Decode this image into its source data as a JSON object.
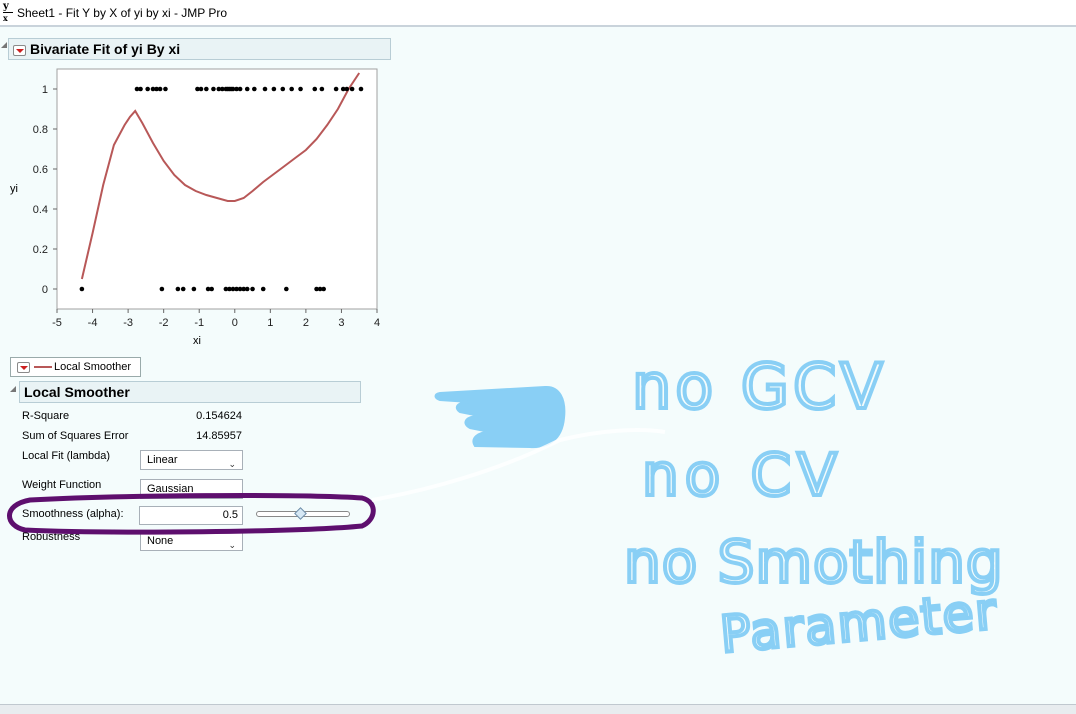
{
  "window": {
    "title": "Sheet1 - Fit Y by X of yi by xi - JMP Pro",
    "icon_text": "y"
  },
  "report": {
    "header": "Bivariate Fit of yi By xi",
    "legend_label": "Local Smoother",
    "smoother_header": "Local Smoother",
    "stats": [
      {
        "label": "R-Square",
        "value": "0.154624"
      },
      {
        "label": "Sum of Squares Error",
        "value": "14.85957"
      }
    ],
    "local_fit": {
      "label": "Local Fit (lambda)",
      "value": "Linear"
    },
    "weight_function": {
      "label": "Weight Function",
      "value": "Gaussian"
    },
    "smoothness": {
      "label": "Smoothness (alpha):",
      "value": "0.5",
      "slider_level": 0.5
    },
    "robustness": {
      "label": "Robustness",
      "value": "None"
    }
  },
  "annotation": {
    "lines": [
      "no GCV",
      "no CV",
      "no Smothing",
      "Parameter"
    ],
    "ink_color": "#89cff5",
    "circle_color": "#5e0f6e"
  },
  "chart_data": {
    "type": "scatter",
    "xlabel": "xi",
    "ylabel": "yi",
    "xlim": [
      -5,
      4
    ],
    "ylim": [
      -0.1,
      1.1
    ],
    "xticks": [
      "-5",
      "-4",
      "-3",
      "-2",
      "-1",
      "0",
      "1",
      "2",
      "3",
      "4"
    ],
    "yticks": [
      "0",
      "0.2",
      "0.4",
      "0.6",
      "0.8",
      "1"
    ],
    "points_y1": [
      -2.75,
      -2.65,
      -2.45,
      -2.3,
      -2.2,
      -2.1,
      -1.95,
      -1.05,
      -0.95,
      -0.8,
      -0.6,
      -0.45,
      -0.35,
      -0.25,
      -0.2,
      -0.15,
      -0.1,
      -0.05,
      0.05,
      0.15,
      0.35,
      0.55,
      0.85,
      1.1,
      1.35,
      1.6,
      1.85,
      2.25,
      2.45,
      2.85,
      3.05,
      3.15,
      3.3,
      3.55
    ],
    "points_y0": [
      -4.3,
      -2.05,
      -1.6,
      -1.45,
      -1.15,
      -0.75,
      -0.65,
      -0.25,
      -0.15,
      -0.05,
      0.05,
      0.15,
      0.25,
      0.35,
      0.5,
      0.8,
      1.45,
      2.3,
      2.4,
      2.5
    ],
    "smoother": {
      "name": "Local Smoother",
      "color": "#b85858",
      "x": [
        -4.3,
        -4.0,
        -3.7,
        -3.4,
        -3.1,
        -2.95,
        -2.8,
        -2.6,
        -2.3,
        -2.0,
        -1.7,
        -1.4,
        -1.1,
        -0.8,
        -0.5,
        -0.2,
        0.0,
        0.25,
        0.5,
        0.8,
        1.1,
        1.4,
        1.7,
        2.0,
        2.3,
        2.6,
        2.9,
        3.2,
        3.5
      ],
      "y": [
        0.05,
        0.28,
        0.52,
        0.72,
        0.82,
        0.86,
        0.89,
        0.83,
        0.73,
        0.64,
        0.57,
        0.52,
        0.49,
        0.47,
        0.455,
        0.44,
        0.44,
        0.455,
        0.49,
        0.535,
        0.575,
        0.615,
        0.655,
        0.695,
        0.75,
        0.82,
        0.9,
        1.0,
        1.08
      ]
    }
  }
}
